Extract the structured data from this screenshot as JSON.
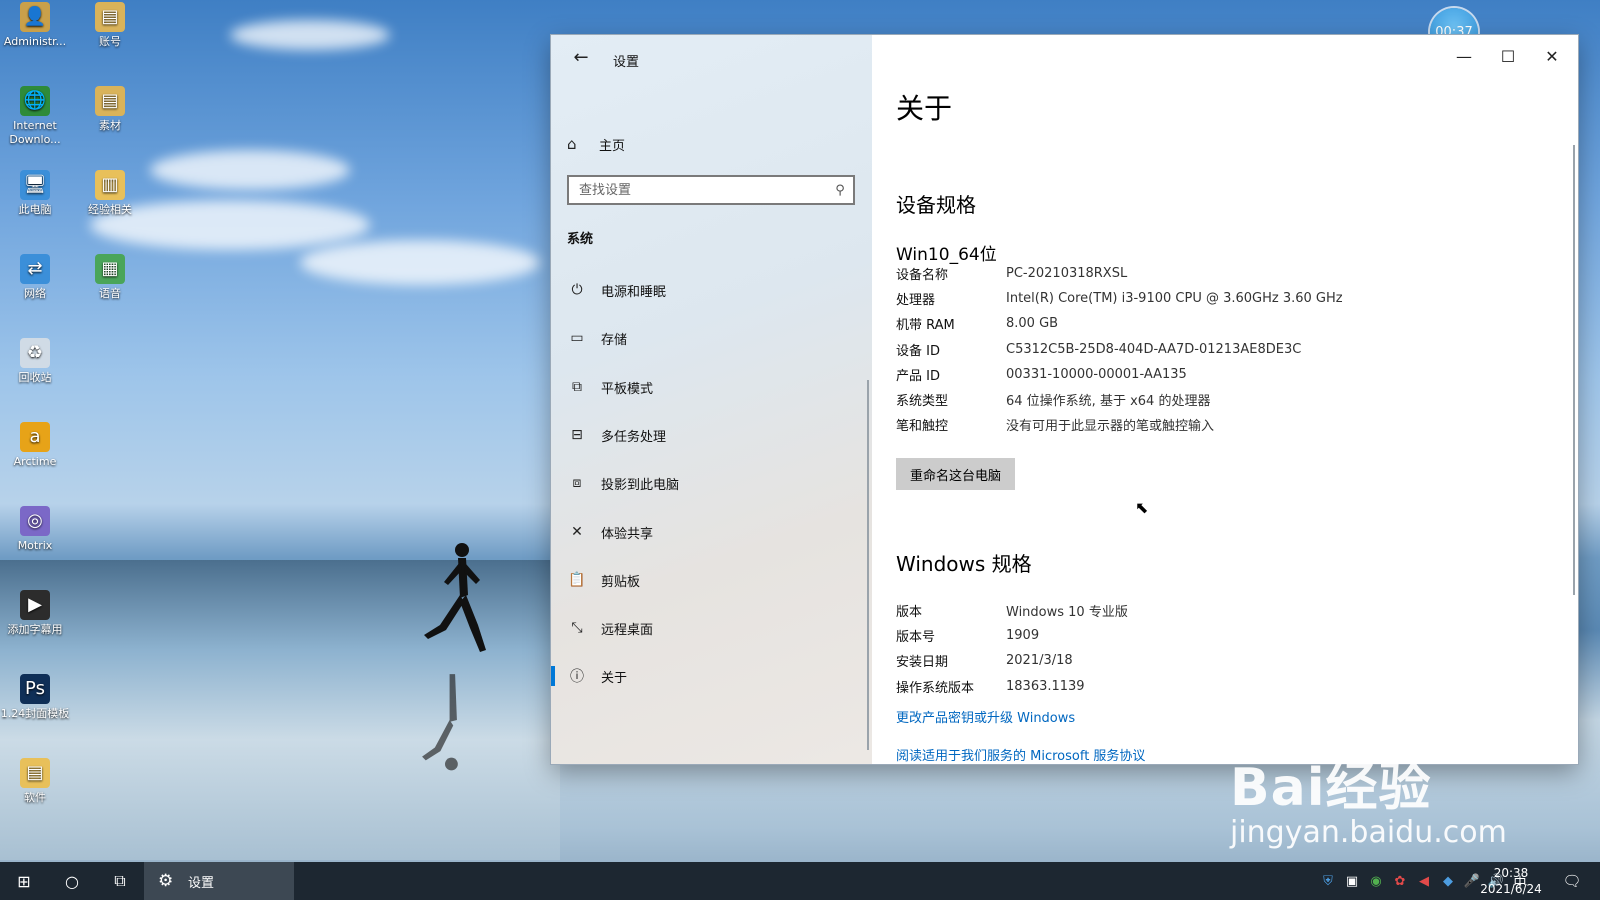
{
  "desktop": {
    "icons": [
      {
        "label": "Administr...",
        "icon": "user-folder-icon",
        "color": "#c9a04a"
      },
      {
        "label": "账号",
        "icon": "document-icon",
        "color": "#d9b35a"
      },
      {
        "label": "Internet Downlo...",
        "icon": "internet-download-manager-icon",
        "color": "#2e8b3a"
      },
      {
        "label": "素材",
        "icon": "document-icon",
        "color": "#d9b35a"
      },
      {
        "label": "此电脑",
        "icon": "computer-icon",
        "color": "#3b8fd9"
      },
      {
        "label": "经验相关",
        "icon": "folder-icon",
        "color": "#e8c05a"
      },
      {
        "label": "网络",
        "icon": "network-icon",
        "color": "#3b8fd9"
      },
      {
        "label": "语音",
        "icon": "spreadsheet-icon",
        "color": "#4aa55a"
      },
      {
        "label": "回收站",
        "icon": "recycle-bin-icon",
        "color": "#d0dbe6"
      },
      {
        "label": "Arctime",
        "icon": "arctime-icon",
        "color": "#e7a318"
      },
      {
        "label": "Motrix",
        "icon": "motrix-icon",
        "color": "#7b68c7"
      },
      {
        "label": "添加字幕用",
        "icon": "shortcut-icon",
        "color": "#2c2c2c"
      },
      {
        "label": "1.24封面模板",
        "icon": "photoshop-icon",
        "color": "#0f2f57"
      },
      {
        "label": "软件",
        "icon": "zip-folder-icon",
        "color": "#e8c05a"
      }
    ],
    "timer": "00:37",
    "watermark": {
      "brand": "Bai经验",
      "url": "jingyan.baidu.com"
    }
  },
  "window": {
    "app_title": "设置",
    "home_label": "主页",
    "search_placeholder": "查找设置",
    "section_label": "系统",
    "nav_items": [
      {
        "label": "电源和睡眠",
        "icon": "power-icon",
        "glyph": "⏻"
      },
      {
        "label": "存储",
        "icon": "storage-icon",
        "glyph": "▭"
      },
      {
        "label": "平板模式",
        "icon": "tablet-mode-icon",
        "glyph": "⧉"
      },
      {
        "label": "多任务处理",
        "icon": "multitasking-icon",
        "glyph": "⊟"
      },
      {
        "label": "投影到此电脑",
        "icon": "project-icon",
        "glyph": "⧈"
      },
      {
        "label": "体验共享",
        "icon": "shared-experiences-icon",
        "glyph": "✕"
      },
      {
        "label": "剪贴板",
        "icon": "clipboard-icon",
        "glyph": "📋"
      },
      {
        "label": "远程桌面",
        "icon": "remote-desktop-icon",
        "glyph": "⤡"
      },
      {
        "label": "关于",
        "icon": "info-icon",
        "glyph": "ⓘ",
        "active": true
      }
    ],
    "content": {
      "title": "关于",
      "device_spec_heading": "设备规格",
      "device_name_heading": "Win10_64位",
      "device_specs": [
        {
          "key": "设备名称",
          "value": "PC-20210318RXSL"
        },
        {
          "key": "处理器",
          "value": "Intel(R) Core(TM) i3-9100 CPU @ 3.60GHz   3.60 GHz"
        },
        {
          "key": "机带 RAM",
          "value": "8.00 GB"
        },
        {
          "key": "设备 ID",
          "value": "C5312C5B-25D8-404D-AA7D-01213AE8DE3C"
        },
        {
          "key": "产品 ID",
          "value": "00331-10000-00001-AA135"
        },
        {
          "key": "系统类型",
          "value": "64 位操作系统, 基于 x64 的处理器"
        },
        {
          "key": "笔和触控",
          "value": "没有可用于此显示器的笔或触控输入"
        }
      ],
      "rename_button": "重命名这台电脑",
      "windows_spec_heading": "Windows 规格",
      "windows_specs": [
        {
          "key": "版本",
          "value": "Windows 10 专业版"
        },
        {
          "key": "版本号",
          "value": "1909"
        },
        {
          "key": "安装日期",
          "value": "2021/3/18"
        },
        {
          "key": "操作系统版本",
          "value": "18363.1139"
        }
      ],
      "link_upgrade": "更改产品密钥或升级 Windows",
      "link_terms": "阅读适用于我们服务的 Microsoft 服务协议"
    }
  },
  "taskbar": {
    "app_label": "设置",
    "ime": "中",
    "time": "20:38",
    "date": "2021/6/24"
  },
  "colors": {
    "accent": "#0078d7",
    "link": "#0067c0",
    "taskbar": "#1d2731"
  }
}
